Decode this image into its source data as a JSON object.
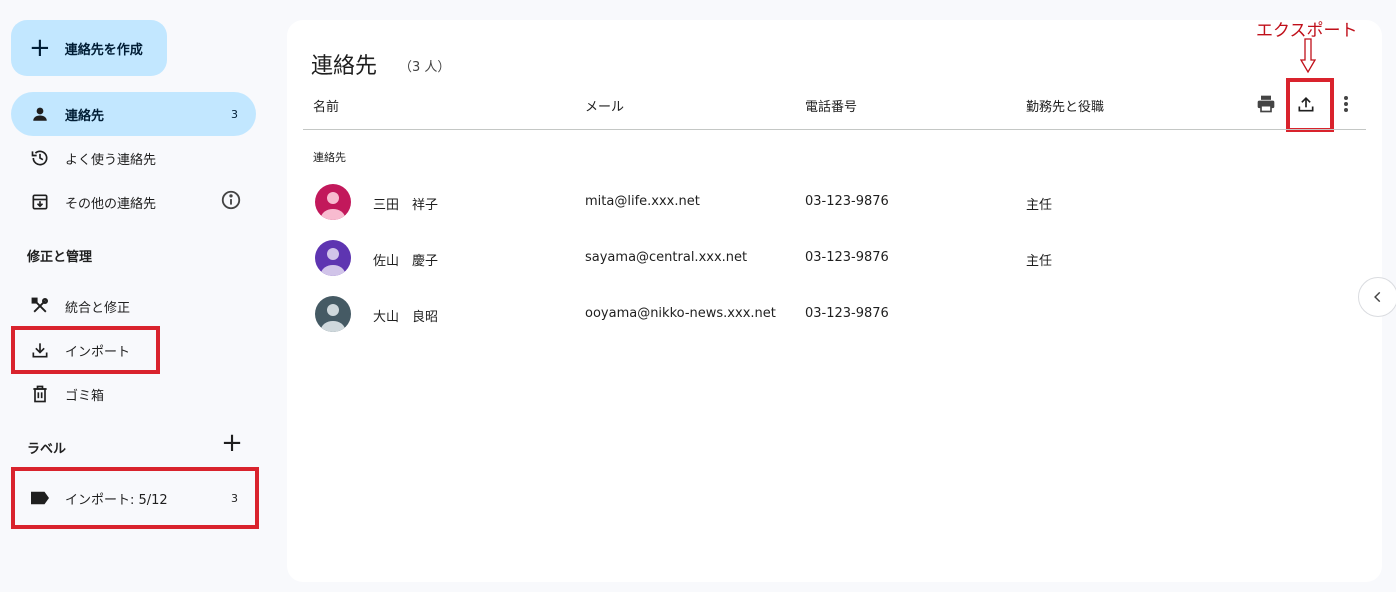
{
  "sidebar": {
    "create_label": "連絡先を作成",
    "items": [
      {
        "label": "連絡先",
        "count": "3",
        "icon": "person-icon"
      },
      {
        "label": "よく使う連絡先",
        "icon": "history-icon"
      },
      {
        "label": "その他の連絡先",
        "icon": "archive-download-icon"
      }
    ],
    "manage_section": "修正と管理",
    "manage_items": [
      {
        "label": "統合と修正",
        "icon": "tools-icon"
      },
      {
        "label": "インポート",
        "icon": "download-icon"
      },
      {
        "label": "ゴミ箱",
        "icon": "trash-icon"
      }
    ],
    "labels_section": "ラベル",
    "label_items": [
      {
        "label": "インポート: 5/12",
        "count": "3",
        "icon": "label-icon"
      }
    ]
  },
  "main": {
    "title": "連絡先",
    "count": "（3 人）",
    "columns": [
      "名前",
      "メール",
      "電話番号",
      "勤務先と役職"
    ],
    "group_label": "連絡先",
    "rows": [
      {
        "name": "三田　祥子",
        "email": "mita@life.xxx.net",
        "phone": "03-123-9876",
        "job": "主任",
        "avatar_color": "#c2185b"
      },
      {
        "name": "佐山　慶子",
        "email": "sayama@central.xxx.net",
        "phone": "03-123-9876",
        "job": "主任",
        "avatar_color": "#5e35b1"
      },
      {
        "name": "大山　良昭",
        "email": "ooyama@nikko-news.xxx.net",
        "phone": "03-123-9876",
        "job": "",
        "avatar_color": "#455a64"
      }
    ]
  },
  "annotation": {
    "export_label": "エクスポート",
    "color": "#d9232d"
  },
  "colors": {
    "accent": "#c2e7ff",
    "background": "#f8f9fc"
  }
}
